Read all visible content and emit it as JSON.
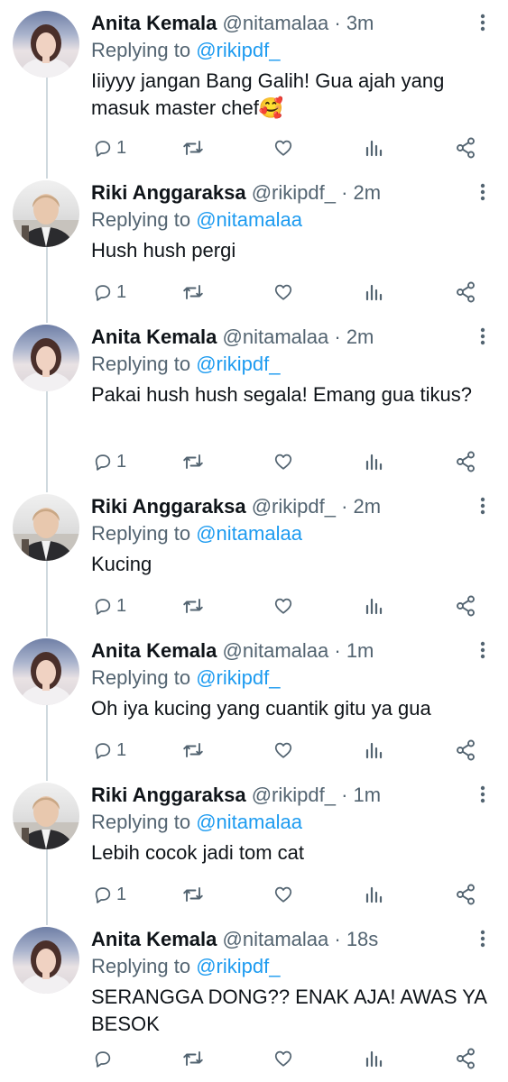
{
  "tweets": [
    {
      "user": "anita",
      "name": "Anita Kemala",
      "handle": "@nitamalaa",
      "time": "· 3m",
      "replying_label": "Replying to",
      "replying_to": "@rikipdf_",
      "text": "Iiiyyy jangan Bang Galih! Gua ajah yang masuk master chef🥰",
      "reply_count": "1"
    },
    {
      "user": "riki",
      "name": "Riki Anggaraksa",
      "handle": "@rikipdf_",
      "time": "· 2m",
      "replying_label": "Replying to",
      "replying_to": "@nitamalaa",
      "text": "Hush hush pergi",
      "reply_count": "1"
    },
    {
      "user": "anita",
      "name": "Anita Kemala",
      "handle": "@nitamalaa",
      "time": "· 2m",
      "replying_label": "Replying to",
      "replying_to": "@rikipdf_",
      "text": "Pakai hush hush segala! Emang gua tikus?",
      "reply_count": "1"
    },
    {
      "user": "riki",
      "name": "Riki Anggaraksa",
      "handle": "@rikipdf_",
      "time": "· 2m",
      "replying_label": "Replying to",
      "replying_to": "@nitamalaa",
      "text": "Kucing",
      "reply_count": "1"
    },
    {
      "user": "anita",
      "name": "Anita Kemala",
      "handle": "@nitamalaa",
      "time": "· 1m",
      "replying_label": "Replying to",
      "replying_to": "@rikipdf_",
      "text": "Oh iya kucing yang cuantik gitu ya gua",
      "reply_count": "1"
    },
    {
      "user": "riki",
      "name": "Riki Anggaraksa",
      "handle": "@rikipdf_",
      "time": "· 1m",
      "replying_label": "Replying to",
      "replying_to": "@nitamalaa",
      "text": "Lebih cocok jadi tom cat",
      "reply_count": "1"
    },
    {
      "user": "anita",
      "name": "Anita Kemala",
      "handle": "@nitamalaa",
      "time": "· 18s",
      "replying_label": "Replying to",
      "replying_to": "@rikipdf_",
      "text": "SERANGGA DONG?? ENAK AJA! AWAS YA BESOK",
      "reply_count": ""
    }
  ],
  "icons": {
    "reply": "reply-icon",
    "retweet": "retweet-icon",
    "like": "heart-icon",
    "views": "analytics-icon",
    "share": "share-icon",
    "more": "more-options-icon"
  },
  "colors": {
    "text": "#0f1419",
    "secondary": "#536471",
    "mention": "#1d9bf0",
    "thread_line": "#cfd9de",
    "background": "#ffffff"
  }
}
